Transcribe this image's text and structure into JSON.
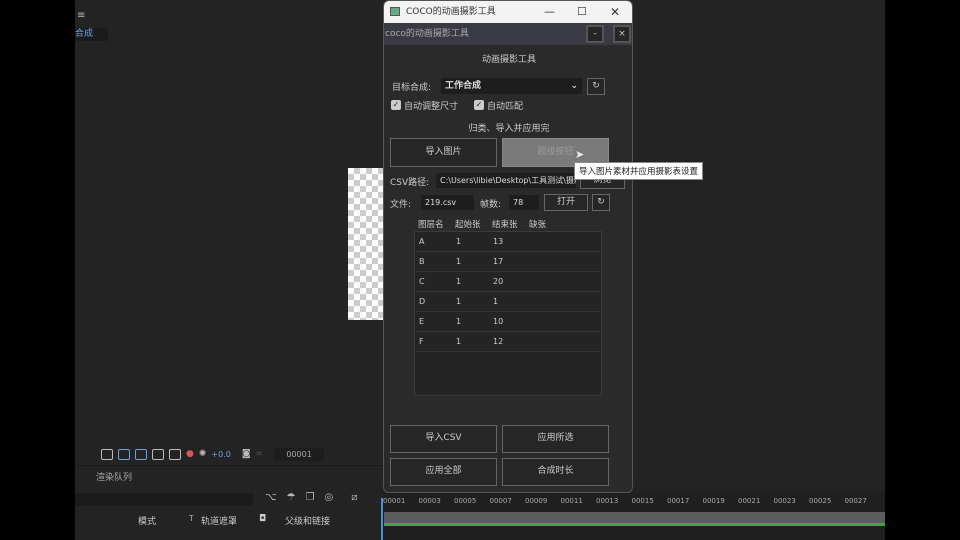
{
  "ae": {
    "top_icon": "menu-icon",
    "comp_tab": "合成",
    "render_queue": "渲染队列",
    "exposure": "+0.0",
    "timecode": "00001",
    "col_mode": "模式",
    "col_t": "T",
    "col_trackmatte": "轨道遮罩",
    "col_parent": "父级和链接",
    "ruler_ticks": [
      "00001",
      "00003",
      "00005",
      "00007",
      "00009",
      "00011",
      "00013",
      "00015",
      "00017",
      "00019",
      "00021",
      "00023",
      "00025",
      "00027"
    ],
    "colors": {
      "accent": "#4a90d9",
      "timeline_green": "#3aa83a"
    }
  },
  "window": {
    "title": "COCO的动画摄影工具",
    "panel_title": "coco的动画摄影工具",
    "min": "-",
    "close": "×",
    "heading": "动画摄影工具",
    "target_label": "目标合成:",
    "target_value": "工作合成",
    "auto_resize": "自动调整尺寸",
    "auto_match": "自动匹配",
    "section": "归类、导入并应用完",
    "import_images": "导入图片",
    "super_button": "超级按钮",
    "tooltip": "导入图片素材并应用摄影表设置",
    "csv_label": "CSV路径:",
    "csv_path": "C:\\Users\\libie\\Desktop\\工具测试\\摄影",
    "browse": "浏览",
    "file_label": "文件:",
    "file_value": "219.csv",
    "frames_label": "帧数:",
    "frames_value": "78",
    "open": "打开",
    "table": {
      "headers": [
        "图层名",
        "起始张",
        "结束张",
        "缺张"
      ],
      "rows": [
        [
          "A",
          "1",
          "13",
          ""
        ],
        [
          "B",
          "1",
          "17",
          ""
        ],
        [
          "C",
          "1",
          "20",
          ""
        ],
        [
          "D",
          "1",
          "1",
          ""
        ],
        [
          "E",
          "1",
          "10",
          ""
        ],
        [
          "F",
          "1",
          "12",
          ""
        ]
      ]
    },
    "import_csv": "导入CSV",
    "apply_selected": "应用所选",
    "apply_all": "应用全部",
    "comp_duration": "合成时长"
  }
}
